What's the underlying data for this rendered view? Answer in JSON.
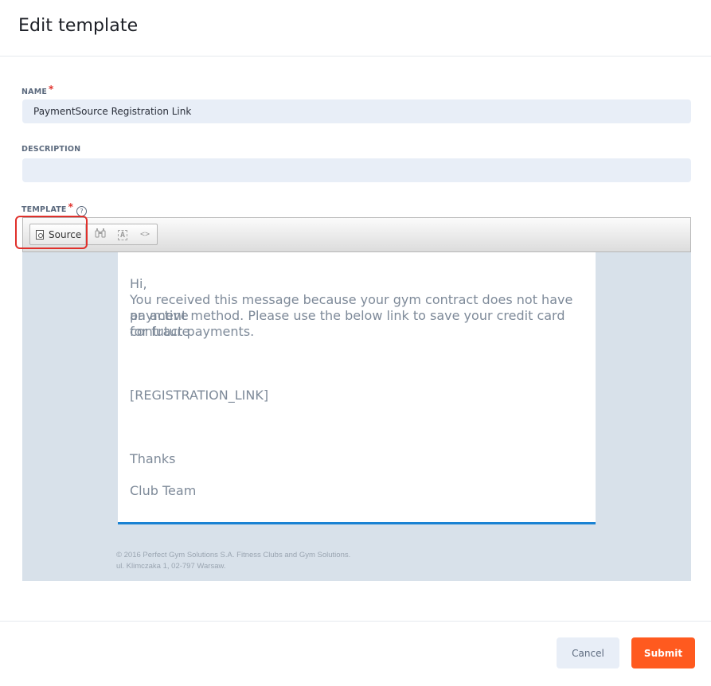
{
  "header": {
    "title": "Edit template"
  },
  "name_field": {
    "label": "NAME",
    "required_mark": "*",
    "value": "PaymentSource Registration Link"
  },
  "description_field": {
    "label": "DESCRIPTION",
    "value": ""
  },
  "template_field": {
    "label": "TEMPLATE",
    "required_mark": "*",
    "help_glyph": "?"
  },
  "toolbar": {
    "source_label": "Source",
    "find_icon": "binoculars-icon",
    "format_icon": "remove-format-icon",
    "code_icon": "code-icon",
    "find_glyph": "🔭",
    "format_glyph": "A",
    "code_glyph": "<>"
  },
  "email": {
    "greeting": "Hi,",
    "body_line_1": "You received this message because your gym contract does not have an active",
    "body_line_2": "payment method. Please use the below link to save your credit card for future",
    "body_line_3": "contract payments.",
    "link_placeholder": "[REGISTRATION_LINK]",
    "thanks": "Thanks",
    "signature": "Club Team",
    "footer_line_1": "© 2016 Perfect Gym Solutions S.A. Fitness Clubs and Gym Solutions.",
    "footer_line_2": "ul. Klimczaka 1, 02-797 Warsaw."
  },
  "actions": {
    "cancel_label": "Cancel",
    "submit_label": "Submit"
  },
  "colors": {
    "accent": "#ff5a1f",
    "highlight": "#e0302b",
    "link_line": "#1a82d3"
  }
}
